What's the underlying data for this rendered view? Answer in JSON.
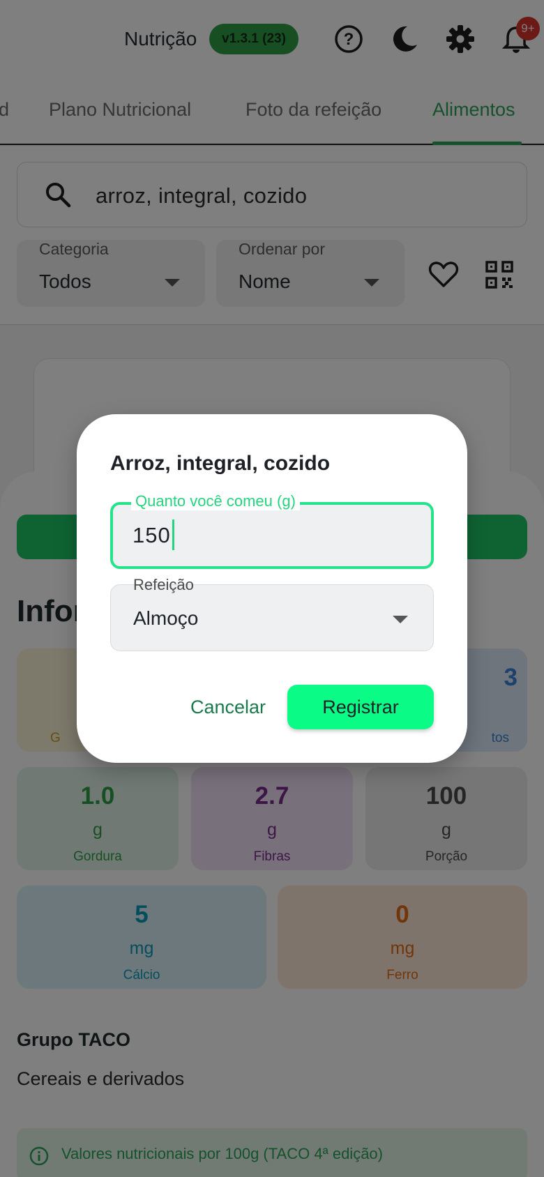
{
  "header": {
    "title": "Nutrição",
    "version": "v1.3.1 (23)",
    "notification_count": "9+",
    "icons": [
      "help-icon",
      "dark-mode-icon",
      "settings-icon",
      "notifications-icon"
    ]
  },
  "tabs": {
    "partial": "d",
    "items": [
      "Plano Nutricional",
      "Foto da refeição",
      "Alimentos"
    ],
    "active": "Alimentos"
  },
  "search": {
    "value": "arroz, integral, cozido"
  },
  "filters": {
    "category": {
      "label": "Categoria",
      "value": "Todos"
    },
    "sort": {
      "label": "Ordenar por",
      "value": "Nome"
    }
  },
  "info": {
    "heading_partial": "Infor",
    "nutrients": [
      {
        "value": "",
        "unit": "",
        "label": "G",
        "color": "#c9a227"
      },
      {
        "value": "3",
        "unit": "",
        "label": "tos",
        "color": "#3b82d6"
      },
      {
        "value": "1.0",
        "unit": "g",
        "label": "Gordura",
        "color": "#2e9e47"
      },
      {
        "value": "2.7",
        "unit": "g",
        "label": "Fibras",
        "color": "#7b2d8e"
      },
      {
        "value": "100",
        "unit": "g",
        "label": "Porção",
        "color": "#4a4a4a"
      },
      {
        "value": "5",
        "unit": "mg",
        "label": "Cálcio",
        "color": "#0b9bb8"
      },
      {
        "value": "0",
        "unit": "mg",
        "label": "Ferro",
        "color": "#e46a12"
      }
    ],
    "group_title": "Grupo TACO",
    "group_value": "Cereais e derivados",
    "note": "Valores nutricionais por 100g (TACO 4ª edição)"
  },
  "dialog": {
    "title": "Arroz, integral, cozido",
    "quantity_label": "Quanto você comeu (g)",
    "quantity_value": "150",
    "meal_label": "Refeição",
    "meal_value": "Almoço",
    "cancel": "Cancelar",
    "confirm": "Registrar"
  },
  "colors": {
    "accent": "#2aa257",
    "dialog_accent": "#25e38a",
    "register_button": "#0bfb87"
  }
}
